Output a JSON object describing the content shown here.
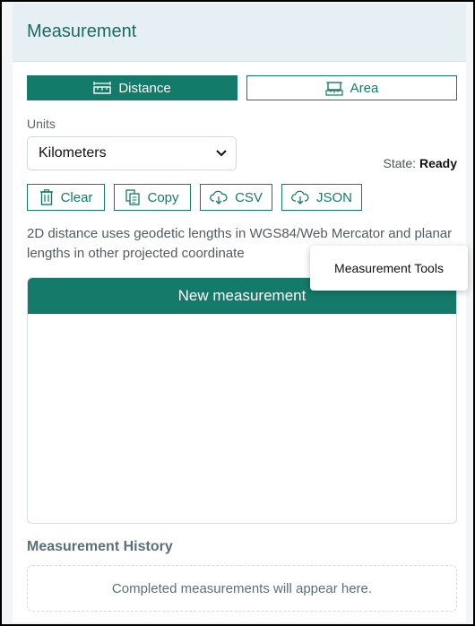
{
  "header": {
    "title": "Measurement"
  },
  "tabs": {
    "distance": {
      "label": "Distance",
      "icon": "ruler-icon"
    },
    "area": {
      "label": "Area",
      "icon": "area-icon"
    }
  },
  "units": {
    "label": "Units",
    "selected": "Kilometers"
  },
  "state": {
    "label": "State:",
    "value": "Ready"
  },
  "actions": {
    "clear": "Clear",
    "copy": "Copy",
    "csv": "CSV",
    "json": "JSON"
  },
  "description": "2D distance uses geodetic lengths in WGS84/Web Mercator and planar lengths in other projected coordinate",
  "tooltip": "Measurement Tools",
  "card": {
    "title": "New measurement"
  },
  "history": {
    "title": "Measurement History",
    "empty": "Completed measurements will appear here."
  },
  "colors": {
    "accent": "#147a69",
    "header_bg": "#e6eff3"
  }
}
